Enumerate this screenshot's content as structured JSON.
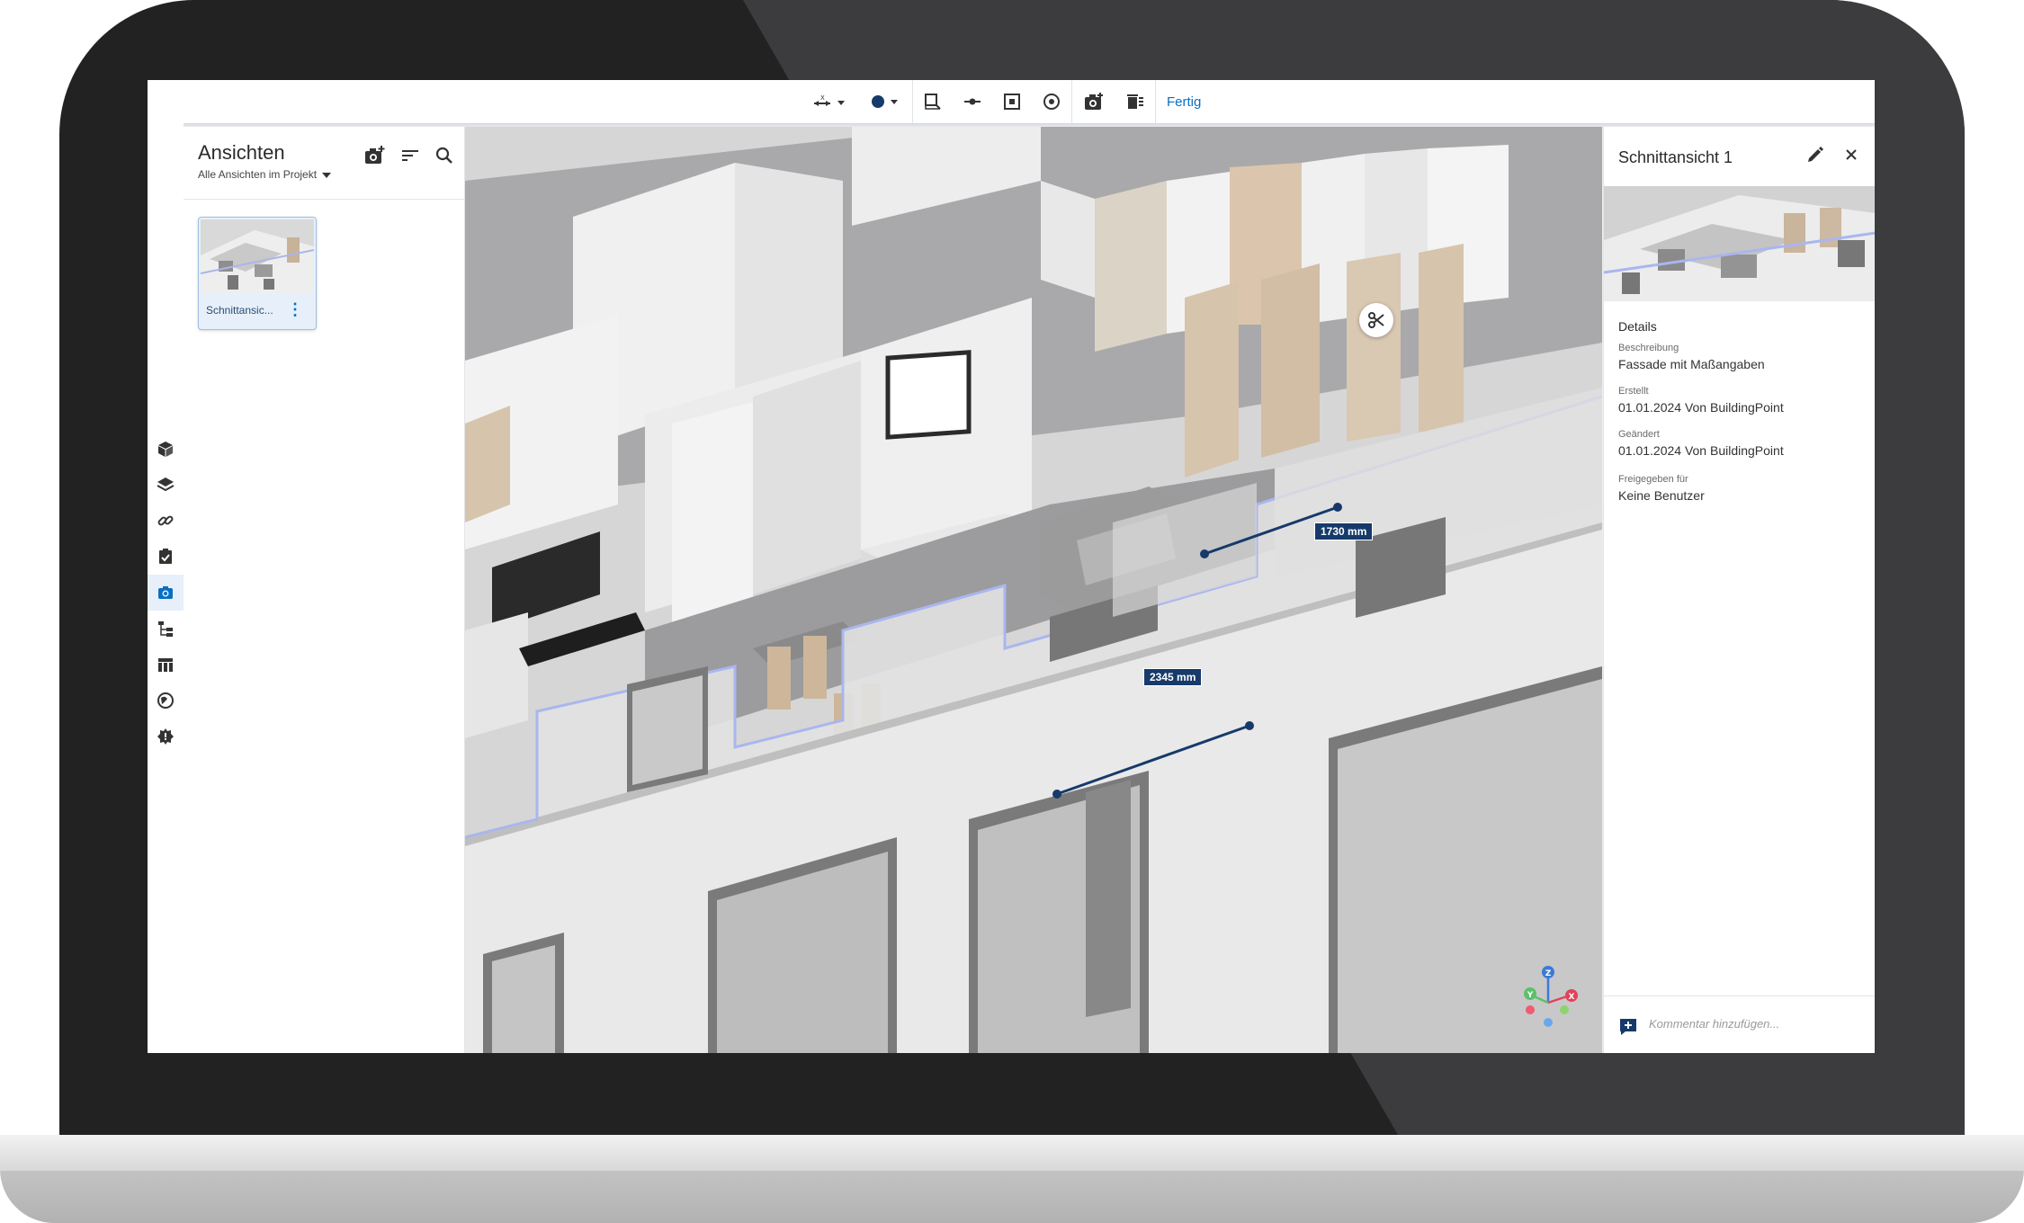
{
  "toolbar": {
    "done_label": "Fertig"
  },
  "left_panel": {
    "title": "Ansichten",
    "filter_label": "Alle Ansichten im Projekt",
    "views": [
      {
        "label": "Schnittansic..."
      }
    ]
  },
  "viewport": {
    "measurements": [
      {
        "label": "1730 mm"
      },
      {
        "label": "2345 mm"
      }
    ],
    "axes": {
      "z": "Z",
      "y": "Y",
      "x": "X"
    }
  },
  "right_panel": {
    "title": "Schnittansicht 1",
    "section_title": "Details",
    "fields": [
      {
        "label": "Beschreibung",
        "value": "Fassade mit Maßangaben"
      },
      {
        "label": "Erstellt",
        "value": "01.01.2024 Von BuildingPoint"
      },
      {
        "label": "Geändert",
        "value": "01.01.2024 Von BuildingPoint"
      },
      {
        "label": "Freigegeben für",
        "value": "Keine Benutzer"
      }
    ],
    "comment_placeholder": "Kommentar hinzufügen..."
  },
  "colors": {
    "accent": "#0a6fc2",
    "measure_bg": "#163a6a",
    "active_rail_bg": "#e6effa"
  },
  "icons": {
    "rail": [
      "cube-icon",
      "layers-icon",
      "link-icon",
      "task-icon",
      "camera-icon",
      "hierarchy-icon",
      "table-icon",
      "globe-icon",
      "settings-icon"
    ],
    "toolbar": [
      "axis-move-icon",
      "color-dot-icon",
      "section-box-icon",
      "section-line-icon",
      "section-plane-icon",
      "target-icon",
      "camera-add-icon",
      "delete-icon"
    ]
  }
}
